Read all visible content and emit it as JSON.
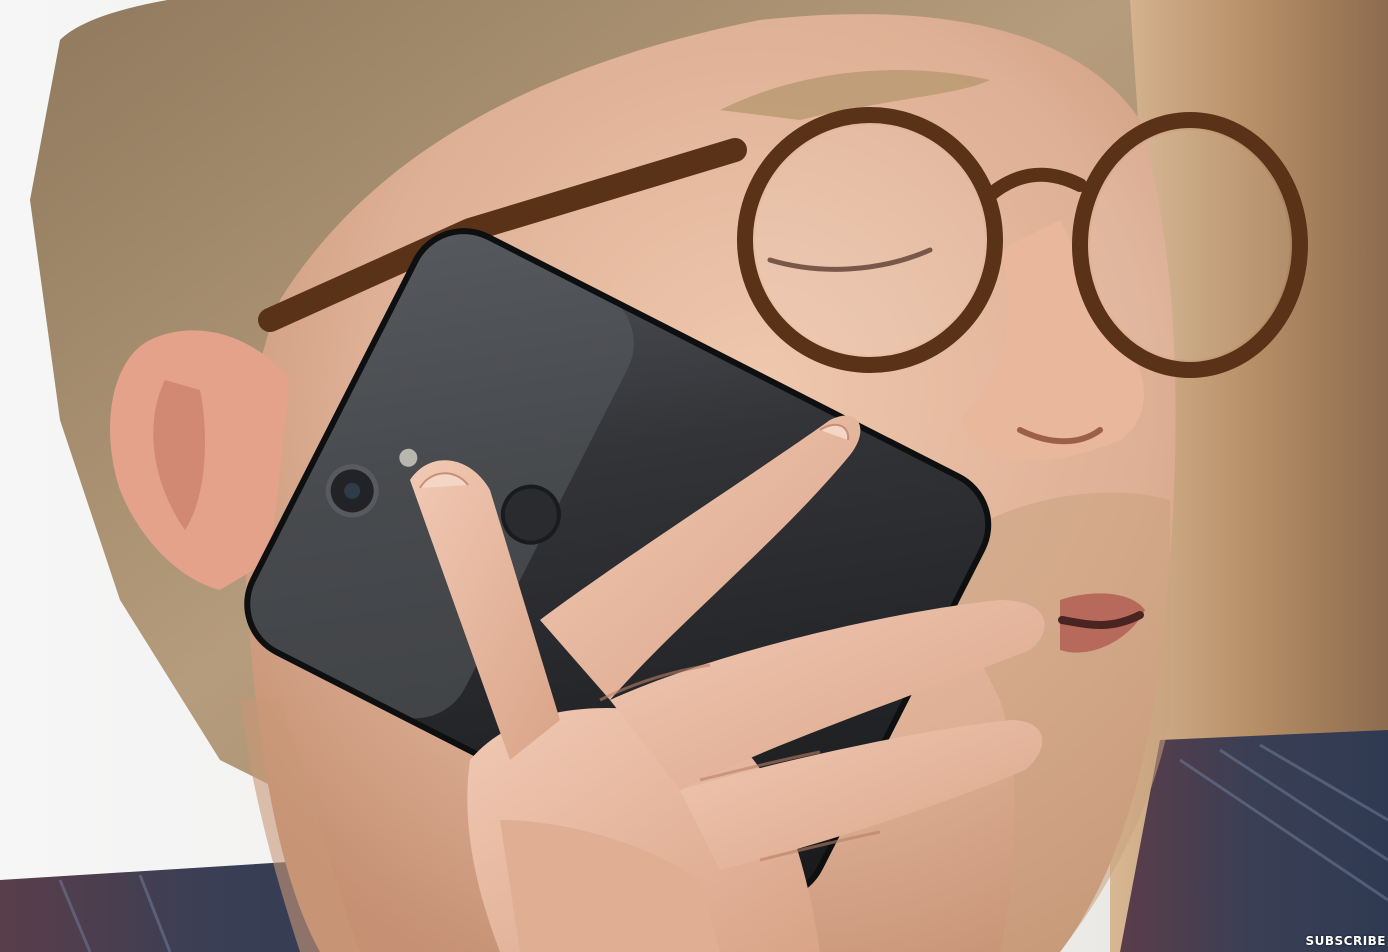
{
  "overlay": {
    "subscribe_text": "SUBSCRIBE"
  },
  "colors": {
    "background_light": "#eeeeee",
    "background_wall": "#c4a07e",
    "skin": "#e2b79d",
    "hair": "#a88e6e",
    "glasses_frame": "#5a3218",
    "phone_body": "#2b2c2f",
    "shirt": "#3d4358"
  }
}
